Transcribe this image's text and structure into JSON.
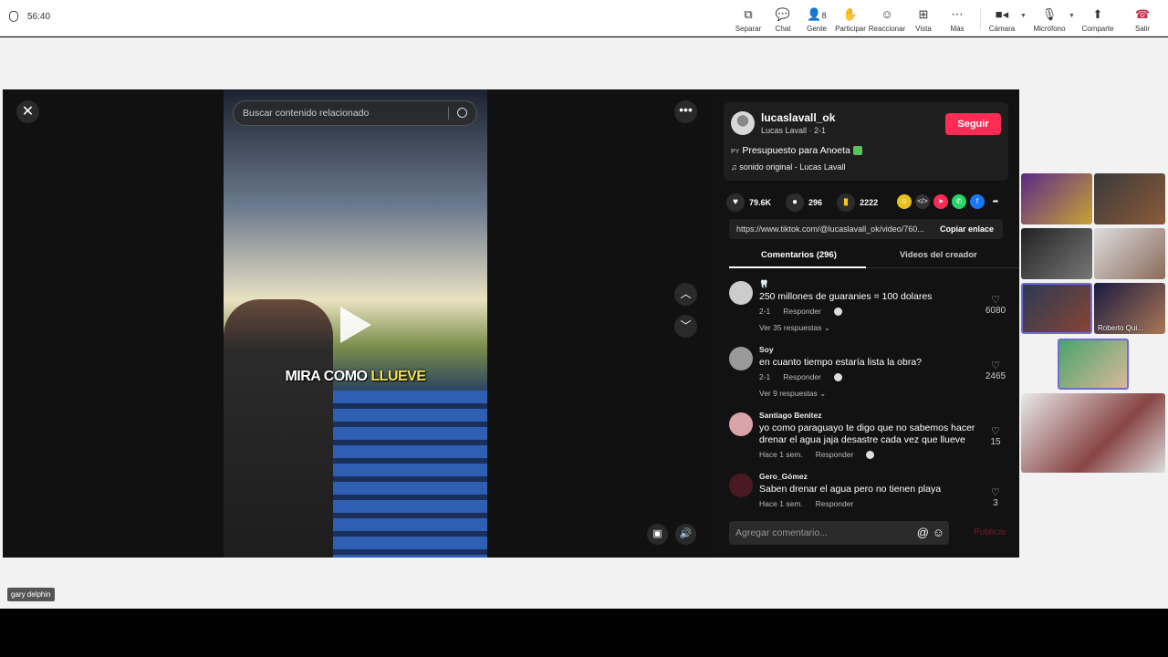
{
  "topbar": {
    "timer": "56:40",
    "people_count": "8",
    "items": [
      {
        "label": "Separar",
        "icon": "pop-out-icon"
      },
      {
        "label": "Chat",
        "icon": "chat-icon"
      },
      {
        "label": "Gente",
        "icon": "people-icon"
      },
      {
        "label": "Participar",
        "icon": "raise-hand-icon"
      },
      {
        "label": "Reaccionar",
        "icon": "react-icon"
      },
      {
        "label": "Vista",
        "icon": "view-icon"
      },
      {
        "label": "Más",
        "icon": "more-icon"
      },
      {
        "label": "Cámara",
        "icon": "camera-icon"
      },
      {
        "label": "Micrófono",
        "icon": "mic-icon"
      },
      {
        "label": "Comparte",
        "icon": "share-icon"
      },
      {
        "label": "Salir",
        "icon": "leave-icon"
      }
    ]
  },
  "video": {
    "search_placeholder": "Buscar contenido relacionado",
    "caption_white": "MIRA COMO ",
    "caption_highlight": "LLUEVE"
  },
  "post": {
    "username": "lucaslavall_ok",
    "subline": "Lucas Lavall · 2-1",
    "follow_label": "Seguir",
    "flag_code": "PY",
    "description": "Presupuesto para Anoeta",
    "sound": "sonido original - Lucas Lavall",
    "likes": "79.6K",
    "comments_count": "296",
    "saves": "2222",
    "link": "https://www.tiktok.com/@lucaslavall_ok/video/760...",
    "copy_link_label": "Copiar enlace",
    "tab_comments": "Comentarios (296)",
    "tab_creator": "Videos del creador",
    "add_comment_placeholder": "Agregar comentario...",
    "publish_label": "Publicar"
  },
  "comments": [
    {
      "user": "🦷",
      "text": "250 millones de guaranies = 100 dolares",
      "date": "2-1",
      "reply_label": "Responder",
      "likes": "6080",
      "replies": "Ver 35 respuestas"
    },
    {
      "user": "Soy",
      "text": "en cuanto tiempo estaría lista la obra?",
      "date": "2-1",
      "reply_label": "Responder",
      "likes": "2465",
      "replies": "Ver 9 respuestas"
    },
    {
      "user": "Santiago Benitez",
      "text": "yo como paraguayo te digo que no sabemos hacer drenar el agua jaja desastre cada vez que llueve",
      "date": "Hace 1 sem.",
      "reply_label": "Responder",
      "likes": "15",
      "replies": ""
    },
    {
      "user": "Gero_Gómez",
      "text": "Saben drenar el agua pero no tienen playa",
      "date": "Hace 1 sem.",
      "reply_label": "Responder",
      "likes": "3",
      "replies": ""
    }
  ],
  "participants": {
    "named_tile": "Roberto Qui...",
    "presenter_tag": "gary delphin"
  },
  "colors": {
    "follow": "#fe2c55",
    "selected_tile_border": "#6f6bd8",
    "leave": "#c4314b"
  }
}
